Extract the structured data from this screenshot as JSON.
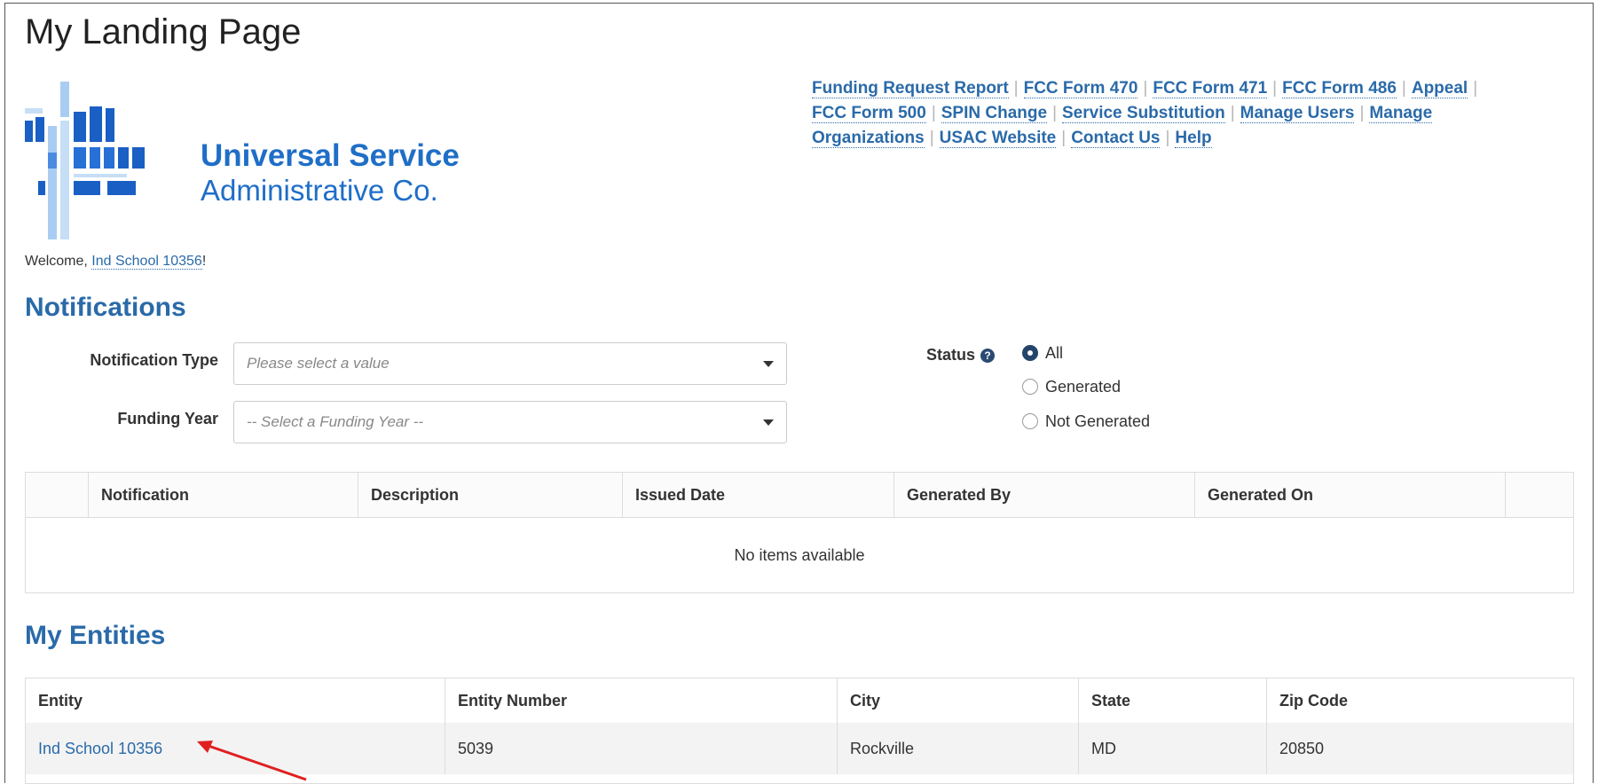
{
  "page": {
    "title": "My Landing Page"
  },
  "logo": {
    "line1": "Universal Service",
    "line2": "Administrative Co."
  },
  "top_links": [
    "Funding Request Report",
    "FCC Form 470",
    "FCC Form 471",
    "FCC Form 486",
    "Appeal",
    "FCC Form 500",
    "SPIN Change",
    "Service Substitution",
    "Manage Users",
    "Manage Organizations",
    "USAC Website",
    "Contact Us",
    "Help"
  ],
  "welcome": {
    "prefix": "Welcome, ",
    "user": "Ind School 10356",
    "suffix": "!"
  },
  "notifications": {
    "title": "Notifications",
    "type_label": "Notification Type",
    "type_placeholder": "Please select a value",
    "year_label": "Funding Year",
    "year_placeholder": "-- Select a Funding Year --",
    "status_label": "Status",
    "status_options": [
      "All",
      "Generated",
      "Not Generated"
    ],
    "status_selected": "All",
    "columns": [
      "Notification",
      "Description",
      "Issued Date",
      "Generated By",
      "Generated On"
    ],
    "empty_text": "No items available"
  },
  "entities": {
    "title": "My Entities",
    "columns": [
      "Entity",
      "Entity Number",
      "City",
      "State",
      "Zip Code"
    ],
    "rows": [
      {
        "entity": "Ind School 10356",
        "number": "5039",
        "city": "Rockville",
        "state": "MD",
        "zip": "20850"
      }
    ]
  },
  "colors": {
    "link": "#2a6aa9",
    "logo": "#1f6ec7",
    "annotation_arrow": "#e02020"
  }
}
